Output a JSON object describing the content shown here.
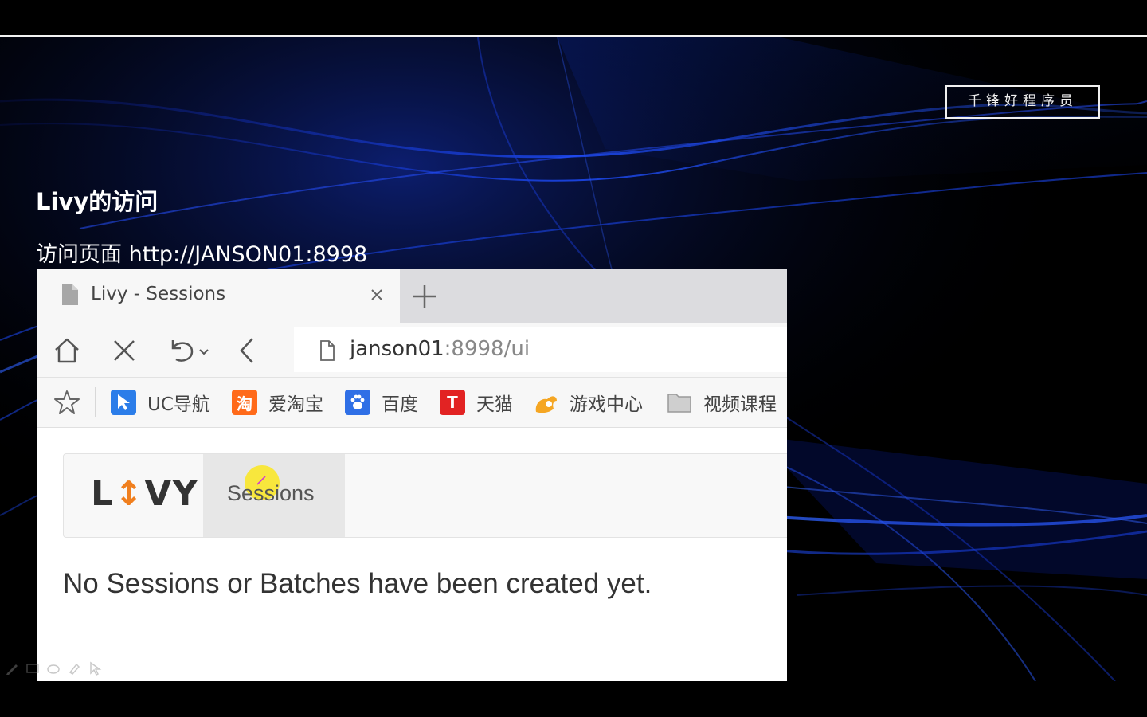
{
  "slide": {
    "brand": "千锋好程序员",
    "title": "Livy的访问",
    "subtitle": "访问页面 http://JANSON01:8998"
  },
  "browser": {
    "tab": {
      "title": "Livy - Sessions"
    },
    "address": {
      "host": "janson01",
      "rest": ":8998/ui"
    },
    "bookmarks": [
      {
        "label": "UC导航",
        "icon": "uc-nav-icon",
        "color": "#2b7de9"
      },
      {
        "label": "爱淘宝",
        "icon": "taobao-icon",
        "color": "#ff6a1a"
      },
      {
        "label": "百度",
        "icon": "baidu-paw-icon",
        "color": "#2f6fe6"
      },
      {
        "label": "天猫",
        "icon": "tmall-icon",
        "color": "#e22323"
      },
      {
        "label": "游戏中心",
        "icon": "game-center-icon",
        "color": "#f5a623"
      },
      {
        "label": "视频课程",
        "icon": "folder-icon",
        "color": "#9a9a9a"
      }
    ]
  },
  "livy": {
    "logo_left": "L",
    "logo_arrow": "↕",
    "logo_right": "VY",
    "nav_sessions": "Sessions",
    "empty_message": "No Sessions or Batches have been created yet."
  },
  "colors": {
    "accent_orange": "#f07f1e",
    "background": "#000000",
    "glow_blue": "#1e4dff"
  }
}
